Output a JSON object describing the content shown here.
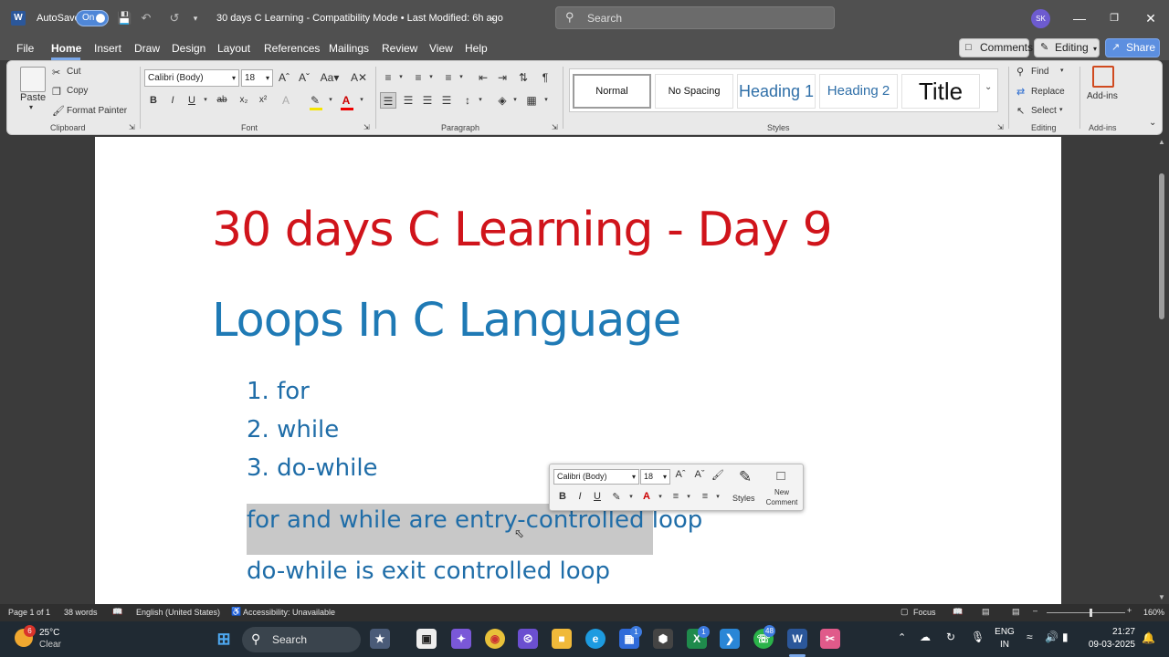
{
  "titlebar": {
    "app_icon": "W",
    "autosave_label": "AutoSave",
    "autosave_state": "On",
    "doc_title": "30 days C Learning  -  Compatibility Mode  •  Last Modified: 6h ago",
    "search_placeholder": "Search",
    "avatar_initials": "SK"
  },
  "menu": {
    "tabs": [
      "File",
      "Home",
      "Insert",
      "Draw",
      "Design",
      "Layout",
      "References",
      "Mailings",
      "Review",
      "View",
      "Help"
    ],
    "comments_label": "Comments",
    "editing_label": "Editing",
    "share_label": "Share"
  },
  "ribbon": {
    "clipboard": {
      "paste": "Paste",
      "cut": "Cut",
      "copy": "Copy",
      "format_painter": "Format Painter",
      "label": "Clipboard"
    },
    "font": {
      "family": "Calibri (Body)",
      "size": "18",
      "label": "Font"
    },
    "paragraph": {
      "label": "Paragraph"
    },
    "styles": {
      "items": [
        "Normal",
        "No Spacing",
        "Heading 1",
        "Heading 2",
        "Title"
      ],
      "label": "Styles"
    },
    "editing": {
      "find": "Find",
      "replace": "Replace",
      "select": "Select",
      "label": "Editing"
    },
    "addins": {
      "button": "Add-ins",
      "label": "Add-ins"
    }
  },
  "document": {
    "title": "30 days C Learning - Day 9",
    "subtitle": "Loops In C Language",
    "list": [
      "1. for",
      "2. while",
      "3. do-while"
    ],
    "para1": "for and while are entry-controlled loop",
    "para2": "do-while is exit controlled loop"
  },
  "mini_toolbar": {
    "font": "Calibri (Body)",
    "size": "18",
    "styles_label": "Styles",
    "new_comment_label": "New Comment"
  },
  "statusbar": {
    "page": "Page 1 of 1",
    "words": "38 words",
    "language": "English (United States)",
    "accessibility": "Accessibility: Unavailable",
    "focus": "Focus",
    "zoom": "160%"
  },
  "taskbar": {
    "weather_temp": "25°C",
    "weather_desc": "Clear",
    "weather_badge": "6",
    "search_placeholder": "Search",
    "store_badge": "1",
    "excel_badge": "1",
    "whatsapp_badge": "48",
    "lang_top": "ENG",
    "lang_bottom": "IN",
    "time": "21:27",
    "date": "09-03-2025"
  },
  "colors": {
    "title_red": "#d0141b",
    "heading_blue": "#1f7ab5",
    "body_blue": "#1f6da8",
    "selection_gray": "#c8c8c8",
    "accent": "#5c8fe0"
  }
}
